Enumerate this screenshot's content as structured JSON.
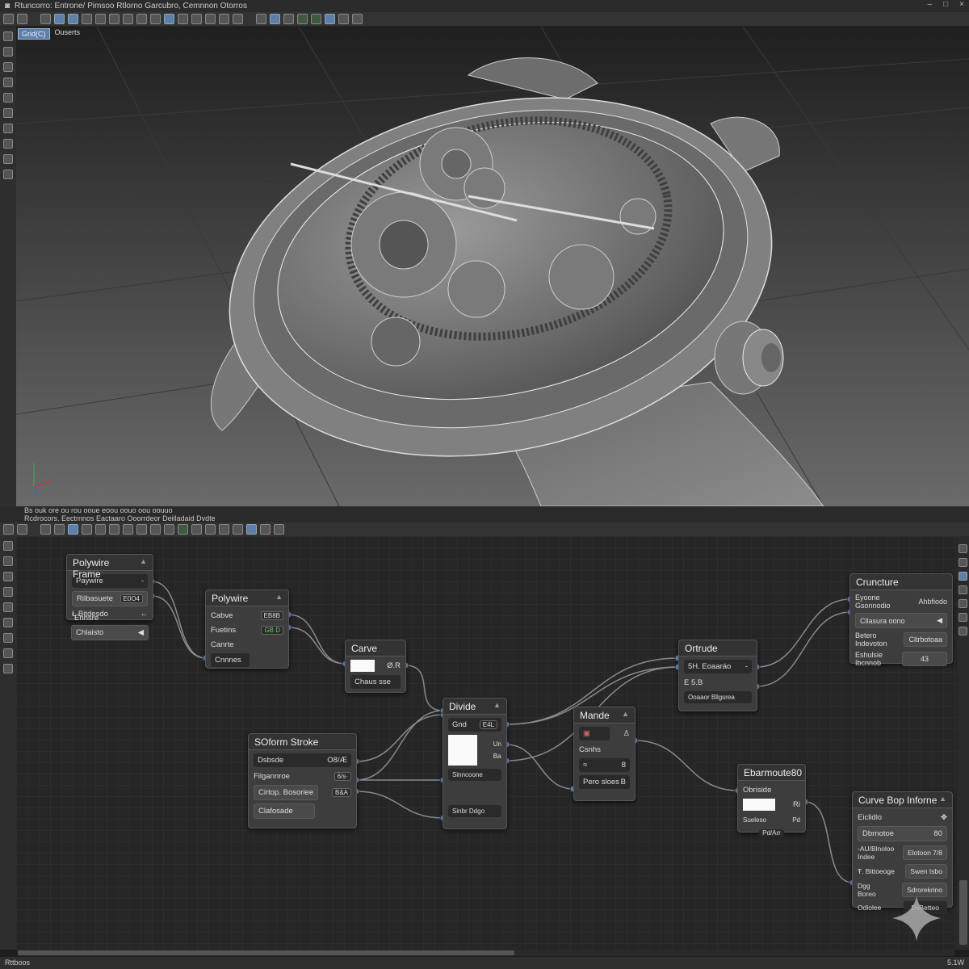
{
  "app": {
    "title": "Rtuncorro: Entrone/ Pimsoo Rtlorno Garcubro, Cemnnon Otorros",
    "window_controls": [
      "–",
      "□",
      "×"
    ]
  },
  "viewport": {
    "tab_active": "Grid(C)",
    "tab_label": "Ouserts"
  },
  "toolbar_icons": [
    "select",
    "paint",
    "cube",
    "sphere",
    "mesh",
    "globe",
    "lattice",
    "grid",
    "brush",
    "wire",
    "shade",
    "lamp",
    "camera",
    "render",
    "material",
    "texture",
    "uv",
    "light",
    "leaf",
    "leaf2",
    "cloud",
    "face",
    "snap",
    "pivot",
    "layers"
  ],
  "left_tools": [
    "move",
    "rotate",
    "scale",
    "edit",
    "shape",
    "frame",
    "extrude",
    "knife",
    "loop",
    "bend"
  ],
  "node_panel": {
    "subtitle": "Bs ouk ore ou rou ooue eoou oouo oou oouuo",
    "title": "Rcdrocors. Eectrnnos Eactaaro Ooorrdeor Deiiladaid Dvdte"
  },
  "node_toolbar_icons": [
    "frame",
    "dome",
    "n1",
    "n2",
    "n3",
    "n4",
    "n5",
    "n6",
    "n7",
    "n8",
    "n9",
    "n10",
    "n11",
    "n12",
    "n13",
    "n14",
    "n15",
    "n16",
    "n17",
    "n18"
  ],
  "right_tools": [
    "r1",
    "r2",
    "r3",
    "r4",
    "r5",
    "r6",
    "r7"
  ],
  "nodes": {
    "polywire_frame": {
      "title": "Polywire Frame",
      "f1": "Paywire",
      "f1v": "-",
      "f2": "Rilbasuete",
      "f2v": "E0O4",
      "f3": "Ł Bitdesdo",
      "f3v": "←",
      "f4": "Ennsre",
      "f5": "Chlaisto"
    },
    "polywire": {
      "title": "Polywire",
      "r1": "Cabve",
      "r1v": "EB8B",
      "r2": "Fuetins",
      "r2v": "GB D",
      "r3": "Canrte",
      "r4": "Cnnnes"
    },
    "carve": {
      "title": "Carve",
      "r1v": "Ø.R",
      "r2": "Chaus sse"
    },
    "divide": {
      "title": "Divide",
      "r1": "Gnd",
      "r1v": "E4L",
      "r2": "Un",
      "r3": "Ba",
      "r4": "Sinncoone",
      "r5": "Sinbr Ddgo"
    },
    "soform": {
      "title": "SOform Stroke",
      "r1": "Dsbsde",
      "r1v": "O8/Æ",
      "r2": "Filgannroe",
      "r2v": "6/s·",
      "r3": "Cirtop. Bosoriee",
      "r3v": "B&A",
      "r4": "Clafosade"
    },
    "mande": {
      "title": "Mande",
      "r1": "Csnhs",
      "r2": "≈",
      "r2v": "8",
      "r3": "Pero sloes",
      "r3v": "B"
    },
    "ortrude": {
      "title": "Ortrude",
      "r1": "5H. Eoaaráo",
      "r1v": "-",
      "r2": "E 5.B",
      "r3": "Ooaaor Bllgsrea"
    },
    "cruncture": {
      "title": "Cruncture",
      "r1": "Eyoone",
      "r1b": "Gsonnodio",
      "r1v": "Ahbfiodo",
      "r2": "Cllasura oono",
      "r3": "Betero",
      "r3b": "Indevoton",
      "r3v": "Cltrbotoaa",
      "r4": "Eshulsie",
      "r4b": "Ibcnnob",
      "r4v": "43"
    },
    "ebarmoute": {
      "title": "Ebarmoute",
      "title_v": "80",
      "r1": "Obriside",
      "r2": "Ri",
      "r3": "Sueleso",
      "r3v": "Pd",
      "r4": "Pd/Arr"
    },
    "curve_bop": {
      "title": "Curve Bop Inforne",
      "r1": "Eiclidlo",
      "r2": "Dbrnotoe",
      "r2v": "80",
      "r3": "-AU/Blnoloo",
      "r3b": "Indee",
      "r3v": "Elotoon 7/8",
      "r4": "Ŧ. Bittoeoge",
      "r4v": "Swen Isbo",
      "r5": "Dgg",
      "r5b": "Boreo",
      "r5v": "Sdrorekrino",
      "r6": "Odiolee",
      "r6v": "BsBetteo"
    }
  },
  "status": {
    "left": "Rttboos",
    "right": "5.1W"
  }
}
